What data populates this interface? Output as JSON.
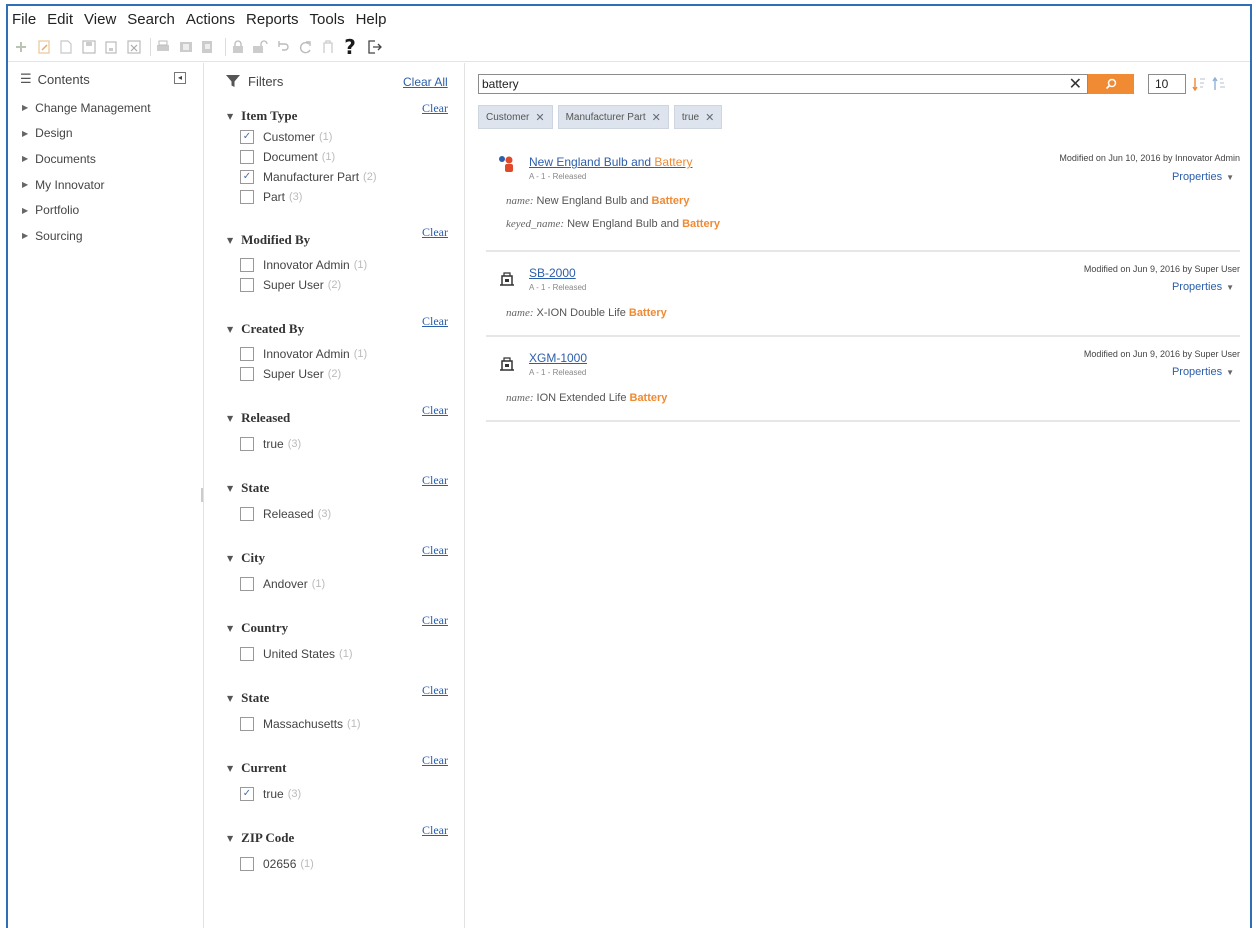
{
  "menu": [
    "File",
    "Edit",
    "View",
    "Search",
    "Actions",
    "Reports",
    "Tools",
    "Help"
  ],
  "toolbar": {
    "icons": [
      "new-item-icon",
      "edit-icon",
      "view-icon",
      "save-icon",
      "save-unlock-close-icon",
      "delete-icon",
      "print-icon",
      "copy-icon",
      "export-icon",
      "lock-icon",
      "unlock-icon",
      "undo-icon",
      "refresh-icon",
      "promote-icon",
      "help-icon",
      "logout-icon"
    ],
    "help_label": "?"
  },
  "contents": {
    "title": "Contents",
    "collapse_label": "◂",
    "items": [
      "Change Management",
      "Design",
      "Documents",
      "My Innovator",
      "Portfolio",
      "Sourcing"
    ]
  },
  "filters": {
    "title": "Filters",
    "clear_all": "Clear All",
    "clear_label": "Clear",
    "groups": [
      {
        "title": "Item Type",
        "options": [
          {
            "label": "Customer",
            "count": "(1)",
            "checked": true
          },
          {
            "label": "Document",
            "count": "(1)",
            "checked": false
          },
          {
            "label": "Manufacturer Part",
            "count": "(2)",
            "checked": true
          },
          {
            "label": "Part",
            "count": "(3)",
            "checked": false
          }
        ]
      },
      {
        "title": "Modified By",
        "options": [
          {
            "label": "Innovator Admin",
            "count": "(1)",
            "checked": false
          },
          {
            "label": "Super User",
            "count": "(2)",
            "checked": false
          }
        ]
      },
      {
        "title": "Created By",
        "options": [
          {
            "label": "Innovator Admin",
            "count": "(1)",
            "checked": false
          },
          {
            "label": "Super User",
            "count": "(2)",
            "checked": false
          }
        ]
      },
      {
        "title": "Released",
        "options": [
          {
            "label": "true",
            "count": "(3)",
            "checked": false
          }
        ]
      },
      {
        "title": "State",
        "options": [
          {
            "label": "Released",
            "count": "(3)",
            "checked": false
          }
        ]
      },
      {
        "title": "City",
        "options": [
          {
            "label": "Andover",
            "count": "(1)",
            "checked": false
          }
        ]
      },
      {
        "title": "Country",
        "options": [
          {
            "label": "United States",
            "count": "(1)",
            "checked": false
          }
        ]
      },
      {
        "title": "State",
        "options": [
          {
            "label": "Massachusetts",
            "count": "(1)",
            "checked": false
          }
        ]
      },
      {
        "title": "Current",
        "options": [
          {
            "label": "true",
            "count": "(3)",
            "checked": true
          }
        ]
      },
      {
        "title": "ZIP Code",
        "options": [
          {
            "label": "02656",
            "count": "(1)",
            "checked": false
          }
        ]
      }
    ]
  },
  "search": {
    "query": "battery",
    "clear_label": "✕",
    "page_size": "10",
    "tags": [
      {
        "label": "Customer",
        "x": "✕"
      },
      {
        "label": "Manufacturer Part",
        "x": "✕"
      },
      {
        "label": "true",
        "x": "✕"
      }
    ]
  },
  "results": [
    {
      "icon": "customer-icon",
      "title_pre": "New England Bulb and ",
      "title_hl": "Battery",
      "sub": "A - 1 - Released",
      "modified": "Modified on Jun 10, 2016 by Innovator Admin",
      "properties": "Properties",
      "lines": [
        {
          "key": "name:",
          "pre": " New England Bulb and ",
          "hl": "Battery"
        },
        {
          "key": "keyed_name:",
          "pre": " New England Bulb and ",
          "hl": "Battery"
        }
      ]
    },
    {
      "icon": "manufacturer-part-icon",
      "title_pre": "SB-2000",
      "title_hl": "",
      "sub": "A - 1 - Released",
      "modified": "Modified on Jun 9, 2016 by Super User",
      "properties": "Properties",
      "lines": [
        {
          "key": "name:",
          "pre": " X-ION Double Life ",
          "hl": "Battery"
        }
      ]
    },
    {
      "icon": "manufacturer-part-icon",
      "title_pre": "XGM-1000",
      "title_hl": "",
      "sub": "A - 1 - Released",
      "modified": "Modified on Jun 9, 2016 by Super User",
      "properties": "Properties",
      "lines": [
        {
          "key": "name:",
          "pre": " ION Extended Life ",
          "hl": "Battery"
        }
      ]
    }
  ],
  "colors": {
    "accent": "#f08a33",
    "link": "#2c5eaa",
    "frame": "#2f6fb5"
  }
}
